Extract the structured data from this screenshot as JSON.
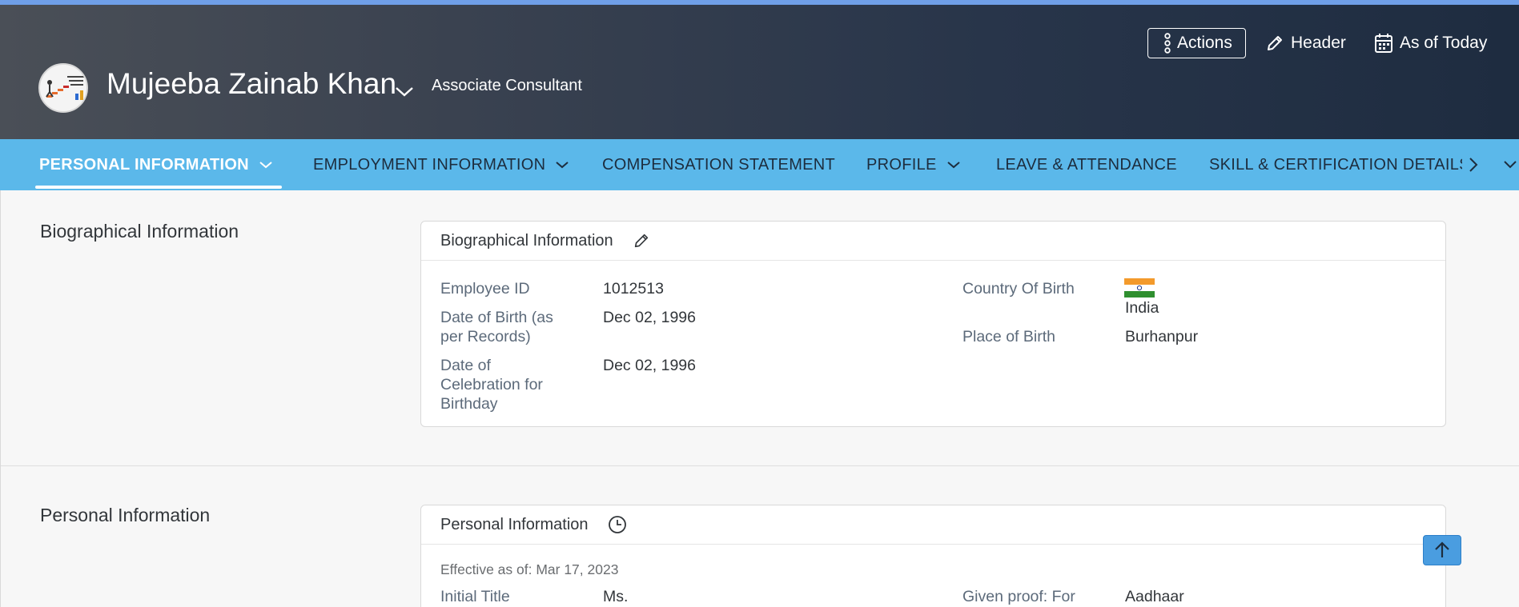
{
  "employee": {
    "name": "Mujeeba Zainab Khan",
    "job_title": "Associate Consultant"
  },
  "header_actions": {
    "actions_label": "Actions",
    "header_label": "Header",
    "as_of_label": "As of Today"
  },
  "tabs": [
    {
      "label": "PERSONAL INFORMATION",
      "active": true,
      "has_dropdown": true
    },
    {
      "label": "EMPLOYMENT INFORMATION",
      "active": false,
      "has_dropdown": true
    },
    {
      "label": "COMPENSATION STATEMENT",
      "active": false,
      "has_dropdown": false
    },
    {
      "label": "PROFILE",
      "active": false,
      "has_dropdown": true
    },
    {
      "label": "LEAVE & ATTENDANCE",
      "active": false,
      "has_dropdown": false
    },
    {
      "label": "SKILL & CERTIFICATION DETAILS",
      "active": false,
      "has_dropdown": false
    }
  ],
  "biographical": {
    "section_label": "Biographical Information",
    "card_title": "Biographical Information",
    "fields_left": [
      {
        "label": "Employee ID",
        "value": "1012513"
      },
      {
        "label": "Date of Birth (as per Records)",
        "value": "Dec 02, 1996"
      },
      {
        "label": "Date of Celebration for Birthday",
        "value": "Dec 02, 1996"
      }
    ],
    "fields_right": [
      {
        "label": "Country Of Birth",
        "value": "India",
        "flag": "india-flag"
      },
      {
        "label": "Place of Birth",
        "value": "Burhanpur"
      }
    ]
  },
  "personal": {
    "section_label": "Personal Information",
    "card_title": "Personal Information",
    "effective_as_of": "Effective as of: Mar 17, 2023",
    "fields_left": [
      {
        "label": "Initial Title",
        "value": "Ms."
      }
    ],
    "fields_right": [
      {
        "label": "Given proof: For",
        "value": "Aadhaar"
      }
    ]
  },
  "colors": {
    "header_dark": "#1e2c40",
    "tabbar_blue": "#5bb8ea",
    "scroll_button_blue": "#4a9de0"
  },
  "icons": {
    "actions": "more-vertical-icon",
    "header": "pencil-icon",
    "as_of": "calendar-icon",
    "bio_edit": "pencil-icon",
    "personal_history": "clock-icon",
    "scroll_top": "arrow-up-icon"
  }
}
